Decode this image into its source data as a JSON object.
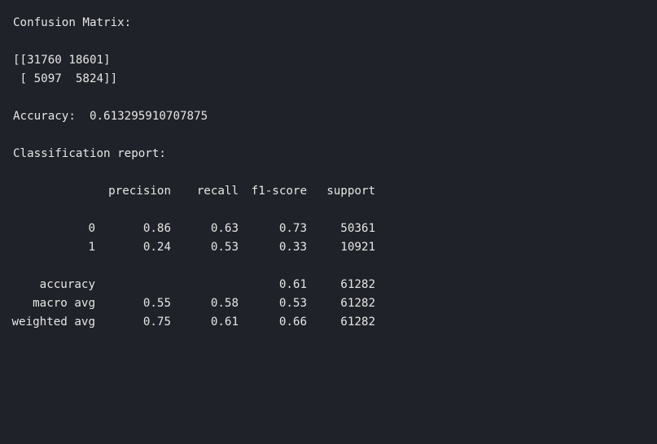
{
  "confusion": {
    "heading": "Confusion Matrix:",
    "line1": "[[31760 18601]",
    "line2": " [ 5097  5824]]"
  },
  "accuracy": {
    "label": "Accuracy:",
    "value": "0.613295910707875"
  },
  "report": {
    "heading": "Classification report:",
    "headers": [
      "precision",
      "recall",
      "f1-score",
      "support"
    ],
    "rows": [
      {
        "label": "0",
        "precision": "0.86",
        "recall": "0.63",
        "f1": "0.73",
        "support": "50361"
      },
      {
        "label": "1",
        "precision": "0.24",
        "recall": "0.53",
        "f1": "0.33",
        "support": "10921"
      }
    ],
    "summary": [
      {
        "label": "accuracy",
        "precision": "",
        "recall": "",
        "f1": "0.61",
        "support": "61282"
      },
      {
        "label": "macro avg",
        "precision": "0.55",
        "recall": "0.58",
        "f1": "0.53",
        "support": "61282"
      },
      {
        "label": "weighted avg",
        "precision": "0.75",
        "recall": "0.61",
        "f1": "0.66",
        "support": "61282"
      }
    ]
  }
}
